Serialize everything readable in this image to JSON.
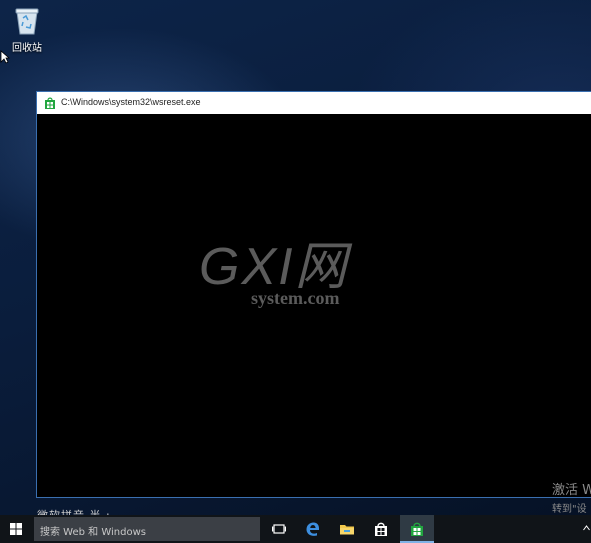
{
  "desktop": {
    "recycle_bin_label": "回收站"
  },
  "window": {
    "title": "C:\\Windows\\system32\\wsreset.exe",
    "watermark_main": "GXI网",
    "watermark_sub": "system.com",
    "activation_line1": "激活 W",
    "activation_line2": "转到\"设",
    "ime_status": "微软拼音 半 :"
  },
  "taskbar": {
    "search_placeholder": "搜索 Web 和 Windows",
    "apps": [
      "start",
      "task-view",
      "edge",
      "file-explorer",
      "store",
      "store-app-active"
    ]
  },
  "colors": {
    "accent": "#1e73c8",
    "store_green": "#22a640"
  }
}
